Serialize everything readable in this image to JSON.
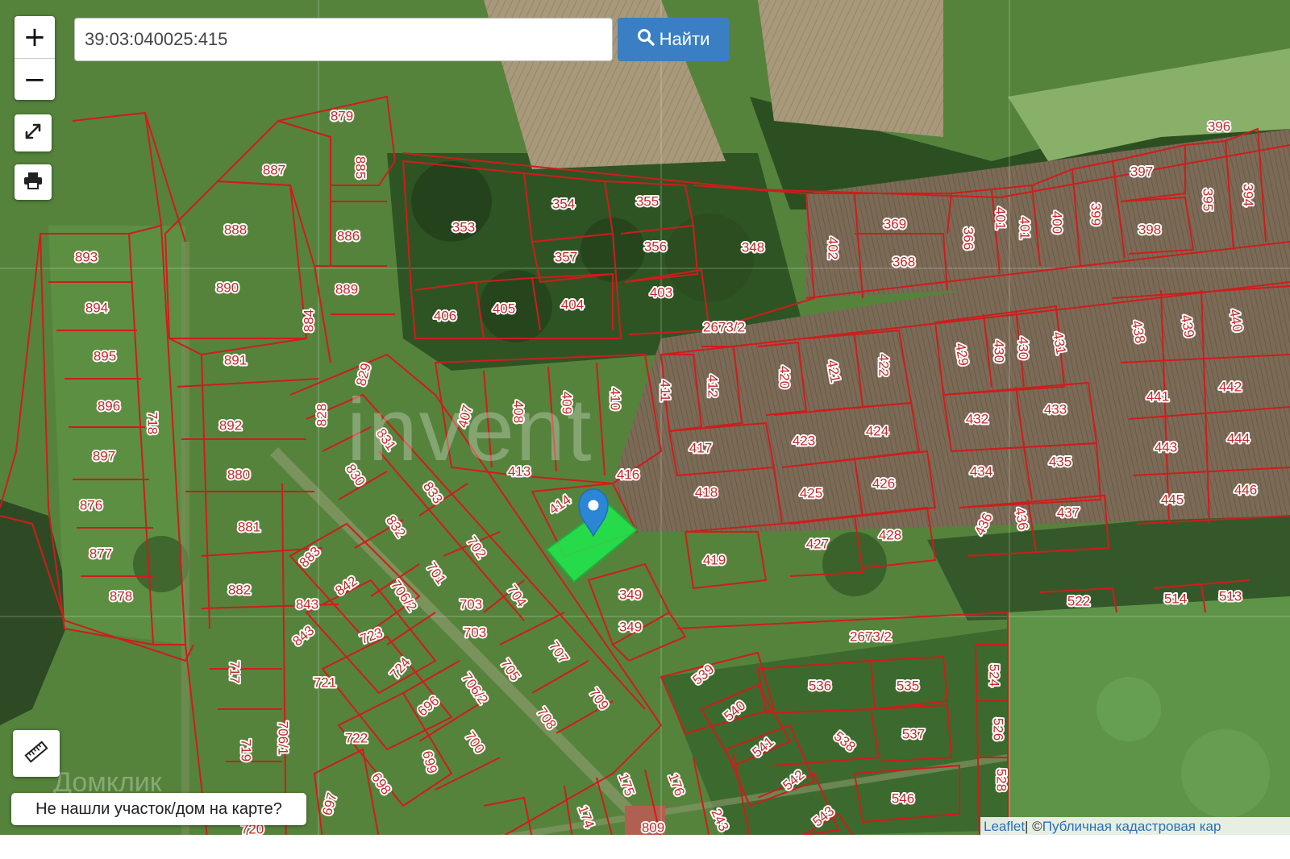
{
  "search": {
    "value": "39:03:040025:415"
  },
  "find_button": {
    "label": "Найти"
  },
  "zoom": {
    "in_label": "+",
    "out_label": "−"
  },
  "not_found_label": "Не нашли участок/дом на карте?",
  "attribution": {
    "leaflet": "Leaflet",
    "separator": " | © ",
    "source": "Публичная кадастровая кар"
  },
  "watermarks": {
    "main": "invent",
    "bottom": "Домклик"
  },
  "icons": {
    "search": "search-icon",
    "fullscreen": "expand-icon",
    "print": "printer-icon",
    "measure": "ruler-icon",
    "marker": "map-marker-icon"
  },
  "colors": {
    "parcel_border": "#d01c1c",
    "selected_parcel": "#22e34a",
    "button": "#3a7fc4",
    "marker": "#2b86d6"
  },
  "map": {
    "selected_parcel": "415",
    "parcel_labels": [
      {
        "text": "879",
        "r": 0
      },
      {
        "text": "885",
        "r": 90
      },
      {
        "text": "887",
        "r": 0
      },
      {
        "text": "888",
        "r": 0
      },
      {
        "text": "886",
        "r": 0
      },
      {
        "text": "893",
        "r": 0
      },
      {
        "text": "890",
        "r": 0
      },
      {
        "text": "889",
        "r": 0
      },
      {
        "text": "894",
        "r": 0
      },
      {
        "text": "884",
        "r": -90
      },
      {
        "text": "895",
        "r": 0
      },
      {
        "text": "891",
        "r": 0
      },
      {
        "text": "829",
        "r": -75
      },
      {
        "text": "896",
        "r": 0
      },
      {
        "text": "718",
        "r": 90
      },
      {
        "text": "828",
        "r": -90
      },
      {
        "text": "892",
        "r": 0
      },
      {
        "text": "897",
        "r": 0
      },
      {
        "text": "831",
        "r": 55
      },
      {
        "text": "880",
        "r": 0
      },
      {
        "text": "830",
        "r": 55
      },
      {
        "text": "833",
        "r": 55
      },
      {
        "text": "876",
        "r": 0
      },
      {
        "text": "881",
        "r": 0
      },
      {
        "text": "832",
        "r": 55
      },
      {
        "text": "702",
        "r": 55
      },
      {
        "text": "877",
        "r": 0
      },
      {
        "text": "883",
        "r": -45
      },
      {
        "text": "701",
        "r": 55
      },
      {
        "text": "842",
        "r": -35
      },
      {
        "text": "878",
        "r": 0
      },
      {
        "text": "882",
        "r": 0
      },
      {
        "text": "706/2",
        "r": 55
      },
      {
        "text": "704",
        "r": 55
      },
      {
        "text": "843",
        "r": 0
      },
      {
        "text": "703",
        "r": 0
      },
      {
        "text": "843",
        "r": -40
      },
      {
        "text": "723",
        "r": -20
      },
      {
        "text": "703",
        "r": 0
      },
      {
        "text": "707",
        "r": 55
      },
      {
        "text": "717",
        "r": 90
      },
      {
        "text": "724",
        "r": -50
      },
      {
        "text": "705",
        "r": 55
      },
      {
        "text": "721",
        "r": 0
      },
      {
        "text": "706/2",
        "r": 55
      },
      {
        "text": "709",
        "r": 55
      },
      {
        "text": "696",
        "r": -40
      },
      {
        "text": "708",
        "r": 55
      },
      {
        "text": "706/1",
        "r": 90
      },
      {
        "text": "722",
        "r": 0
      },
      {
        "text": "700",
        "r": 55
      },
      {
        "text": "719",
        "r": 90
      },
      {
        "text": "699",
        "r": 75
      },
      {
        "text": "698",
        "r": 55
      },
      {
        "text": "697",
        "r": -75
      },
      {
        "text": "720",
        "r": 0
      },
      {
        "text": "175",
        "r": 70
      },
      {
        "text": "176",
        "r": 70
      },
      {
        "text": "174",
        "r": 70
      },
      {
        "text": "809",
        "r": 0
      },
      {
        "text": "243",
        "r": 65
      },
      {
        "text": "354",
        "r": 0
      },
      {
        "text": "355",
        "r": 0
      },
      {
        "text": "353",
        "r": 0
      },
      {
        "text": "357",
        "r": 0
      },
      {
        "text": "356",
        "r": 0
      },
      {
        "text": "348",
        "r": 0
      },
      {
        "text": "406",
        "r": 0
      },
      {
        "text": "405",
        "r": 0
      },
      {
        "text": "404",
        "r": 0
      },
      {
        "text": "403",
        "r": 0
      },
      {
        "text": "2673/2",
        "r": 0
      },
      {
        "text": "407",
        "r": -75
      },
      {
        "text": "408",
        "r": 90
      },
      {
        "text": "409",
        "r": 90
      },
      {
        "text": "410",
        "r": 90
      },
      {
        "text": "411",
        "r": 90
      },
      {
        "text": "412",
        "r": 90
      },
      {
        "text": "413",
        "r": 0
      },
      {
        "text": "416",
        "r": 0
      },
      {
        "text": "417",
        "r": 0
      },
      {
        "text": "418",
        "r": 0
      },
      {
        "text": "414",
        "r": -35
      },
      {
        "text": "419",
        "r": 0
      },
      {
        "text": "349",
        "r": 0
      },
      {
        "text": "349",
        "r": 0
      },
      {
        "text": "2673/2",
        "r": 0
      },
      {
        "text": "539",
        "r": -40
      },
      {
        "text": "540",
        "r": -40
      },
      {
        "text": "541",
        "r": -40
      },
      {
        "text": "542",
        "r": -40
      },
      {
        "text": "543",
        "r": -40
      },
      {
        "text": "536",
        "r": 0
      },
      {
        "text": "535",
        "r": 0
      },
      {
        "text": "538",
        "r": 40
      },
      {
        "text": "537",
        "r": 0
      },
      {
        "text": "546",
        "r": 0
      },
      {
        "text": "524",
        "r": 90
      },
      {
        "text": "526",
        "r": 90
      },
      {
        "text": "528",
        "r": 90
      },
      {
        "text": "420",
        "r": 90
      },
      {
        "text": "421",
        "r": 80
      },
      {
        "text": "422",
        "r": 90
      },
      {
        "text": "423",
        "r": 0
      },
      {
        "text": "424",
        "r": 0
      },
      {
        "text": "425",
        "r": 0
      },
      {
        "text": "426",
        "r": 0
      },
      {
        "text": "427",
        "r": 0
      },
      {
        "text": "428",
        "r": 0
      },
      {
        "text": "402",
        "r": 90
      },
      {
        "text": "369",
        "r": 0
      },
      {
        "text": "368",
        "r": 0
      },
      {
        "text": "366",
        "r": 90
      },
      {
        "text": "401",
        "r": 90
      },
      {
        "text": "401",
        "r": 90
      },
      {
        "text": "400",
        "r": 90
      },
      {
        "text": "399",
        "r": 90
      },
      {
        "text": "397",
        "r": 0
      },
      {
        "text": "398",
        "r": 0
      },
      {
        "text": "396",
        "r": 0
      },
      {
        "text": "395",
        "r": 90
      },
      {
        "text": "394",
        "r": 90
      },
      {
        "text": "429",
        "r": 80
      },
      {
        "text": "430",
        "r": 90
      },
      {
        "text": "430",
        "r": 90
      },
      {
        "text": "431",
        "r": 80
      },
      {
        "text": "438",
        "r": 80
      },
      {
        "text": "439",
        "r": 80
      },
      {
        "text": "440",
        "r": 80
      },
      {
        "text": "432",
        "r": 0
      },
      {
        "text": "433",
        "r": 0
      },
      {
        "text": "441",
        "r": 0
      },
      {
        "text": "442",
        "r": 0
      },
      {
        "text": "434",
        "r": 0
      },
      {
        "text": "435",
        "r": 0
      },
      {
        "text": "443",
        "r": 0
      },
      {
        "text": "444",
        "r": 0
      },
      {
        "text": "436",
        "r": -65
      },
      {
        "text": "436",
        "r": 80
      },
      {
        "text": "437",
        "r": 0
      },
      {
        "text": "445",
        "r": 0
      },
      {
        "text": "446",
        "r": 0
      },
      {
        "text": "522",
        "r": 0
      },
      {
        "text": "514",
        "r": 0
      },
      {
        "text": "513",
        "r": 0
      }
    ]
  }
}
